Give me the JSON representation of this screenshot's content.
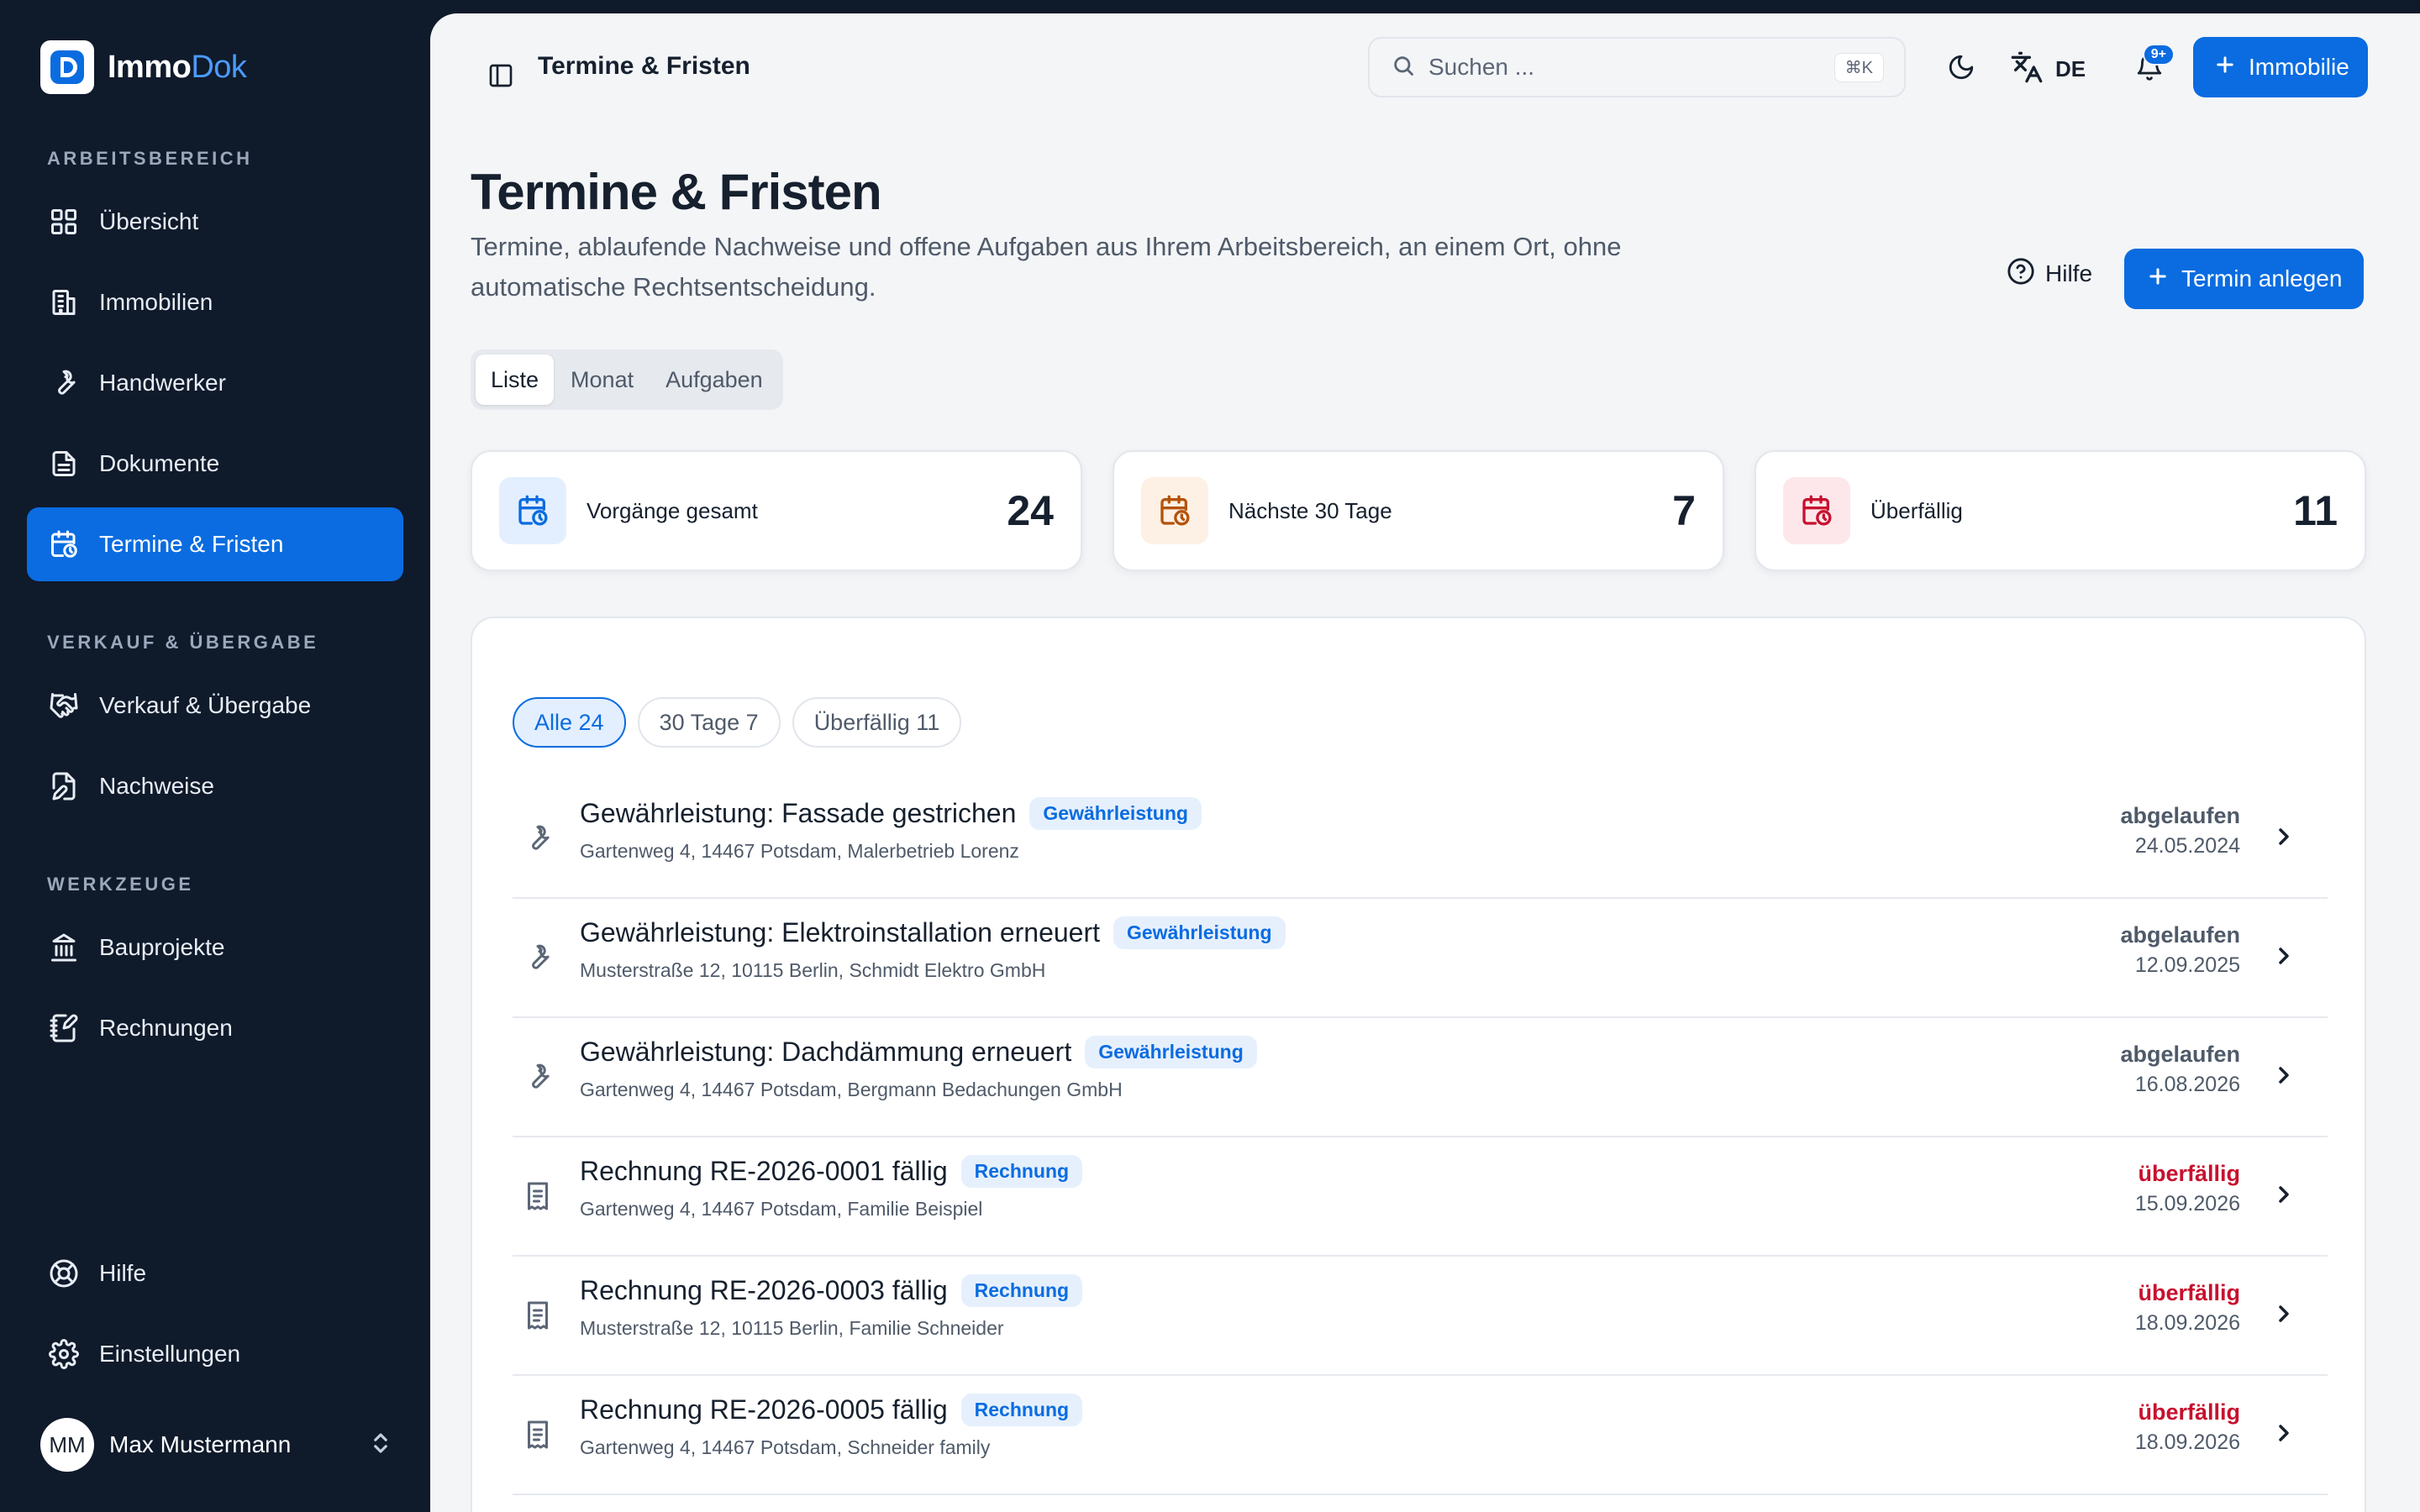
{
  "brand": {
    "name_primary": "Immo",
    "name_accent": "Dok"
  },
  "colors": {
    "sidebar_bg": "#0f1a2b",
    "accent": "#0a6ce0",
    "overdue": "#c8102e",
    "expired": "#4f5a69",
    "badge_bg": "#e6f0fd"
  },
  "sidebar": {
    "sections": [
      {
        "label": "ARBEITSBEREICH"
      },
      {
        "label": "VERKAUF & ÜBERGABE"
      },
      {
        "label": "WERKZEUGE"
      }
    ],
    "items": [
      {
        "label": "Übersicht",
        "icon": "grid-icon"
      },
      {
        "label": "Immobilien",
        "icon": "building-icon"
      },
      {
        "label": "Handwerker",
        "icon": "wrench-icon"
      },
      {
        "label": "Dokumente",
        "icon": "document-icon"
      },
      {
        "label": "Termine & Fristen",
        "icon": "calendar-clock-icon",
        "active": true
      },
      {
        "label": "Verkauf & Übergabe",
        "icon": "handshake-icon"
      },
      {
        "label": "Nachweise",
        "icon": "file-edit-icon"
      },
      {
        "label": "Bauprojekte",
        "icon": "landmark-icon"
      },
      {
        "label": "Rechnungen",
        "icon": "notebook-pen-icon"
      },
      {
        "label": "Hilfe",
        "icon": "life-buoy-icon"
      },
      {
        "label": "Einstellungen",
        "icon": "gear-icon"
      }
    ],
    "user": {
      "initials": "MM",
      "name": "Max Mustermann"
    }
  },
  "topbar": {
    "title": "Termine & Fristen",
    "search_placeholder": "Suchen ...",
    "search_shortcut": "⌘K",
    "language": "DE",
    "notifications_badge": "9+",
    "add_button": "Immobilie"
  },
  "page": {
    "title": "Termine & Fristen",
    "subtitle": "Termine, ablaufende Nachweise und offene Aufgaben aus Ihrem Arbeitsbereich, an einem Ort, ohne automatische Rechtsentscheidung.",
    "help_label": "Hilfe",
    "new_button": "Termin anlegen",
    "views": [
      "Liste",
      "Monat",
      "Aufgaben"
    ],
    "active_view": "Liste"
  },
  "stats": [
    {
      "label": "Vorgänge gesamt",
      "value": "24"
    },
    {
      "label": "Nächste 30 Tage",
      "value": "7"
    },
    {
      "label": "Überfällig",
      "value": "11"
    }
  ],
  "filters": [
    {
      "label": "Alle 24",
      "active": true
    },
    {
      "label": "30 Tage 7",
      "active": false
    },
    {
      "label": "Überfällig 11",
      "active": false
    }
  ],
  "rows": [
    {
      "icon": "wrench-icon",
      "title": "Gewährleistung: Fassade gestrichen",
      "badge": "Gewährleistung",
      "subtitle": "Gartenweg 4, 14467 Potsdam, Malerbetrieb Lorenz",
      "status": "abgelaufen",
      "date": "24.05.2024"
    },
    {
      "icon": "wrench-icon",
      "title": "Gewährleistung: Elektroinstallation erneuert",
      "badge": "Gewährleistung",
      "subtitle": "Musterstraße 12, 10115 Berlin, Schmidt Elektro GmbH",
      "status": "abgelaufen",
      "date": "12.09.2025"
    },
    {
      "icon": "wrench-icon",
      "title": "Gewährleistung: Dachdämmung erneuert",
      "badge": "Gewährleistung",
      "subtitle": "Gartenweg 4, 14467 Potsdam, Bergmann Bedachungen GmbH",
      "status": "abgelaufen",
      "date": "16.08.2026"
    },
    {
      "icon": "receipt-icon",
      "title": "Rechnung RE-2026-0001 fällig",
      "badge": "Rechnung",
      "subtitle": "Gartenweg 4, 14467 Potsdam, Familie Beispiel",
      "status": "überfällig",
      "date": "15.09.2026"
    },
    {
      "icon": "receipt-icon",
      "title": "Rechnung RE-2026-0003 fällig",
      "badge": "Rechnung",
      "subtitle": "Musterstraße 12, 10115 Berlin, Familie Schneider",
      "status": "überfällig",
      "date": "18.09.2026"
    },
    {
      "icon": "receipt-icon",
      "title": "Rechnung RE-2026-0005 fällig",
      "badge": "Rechnung",
      "subtitle": "Gartenweg 4, 14467 Potsdam, Schneider family",
      "status": "überfällig",
      "date": "18.09.2026"
    }
  ]
}
